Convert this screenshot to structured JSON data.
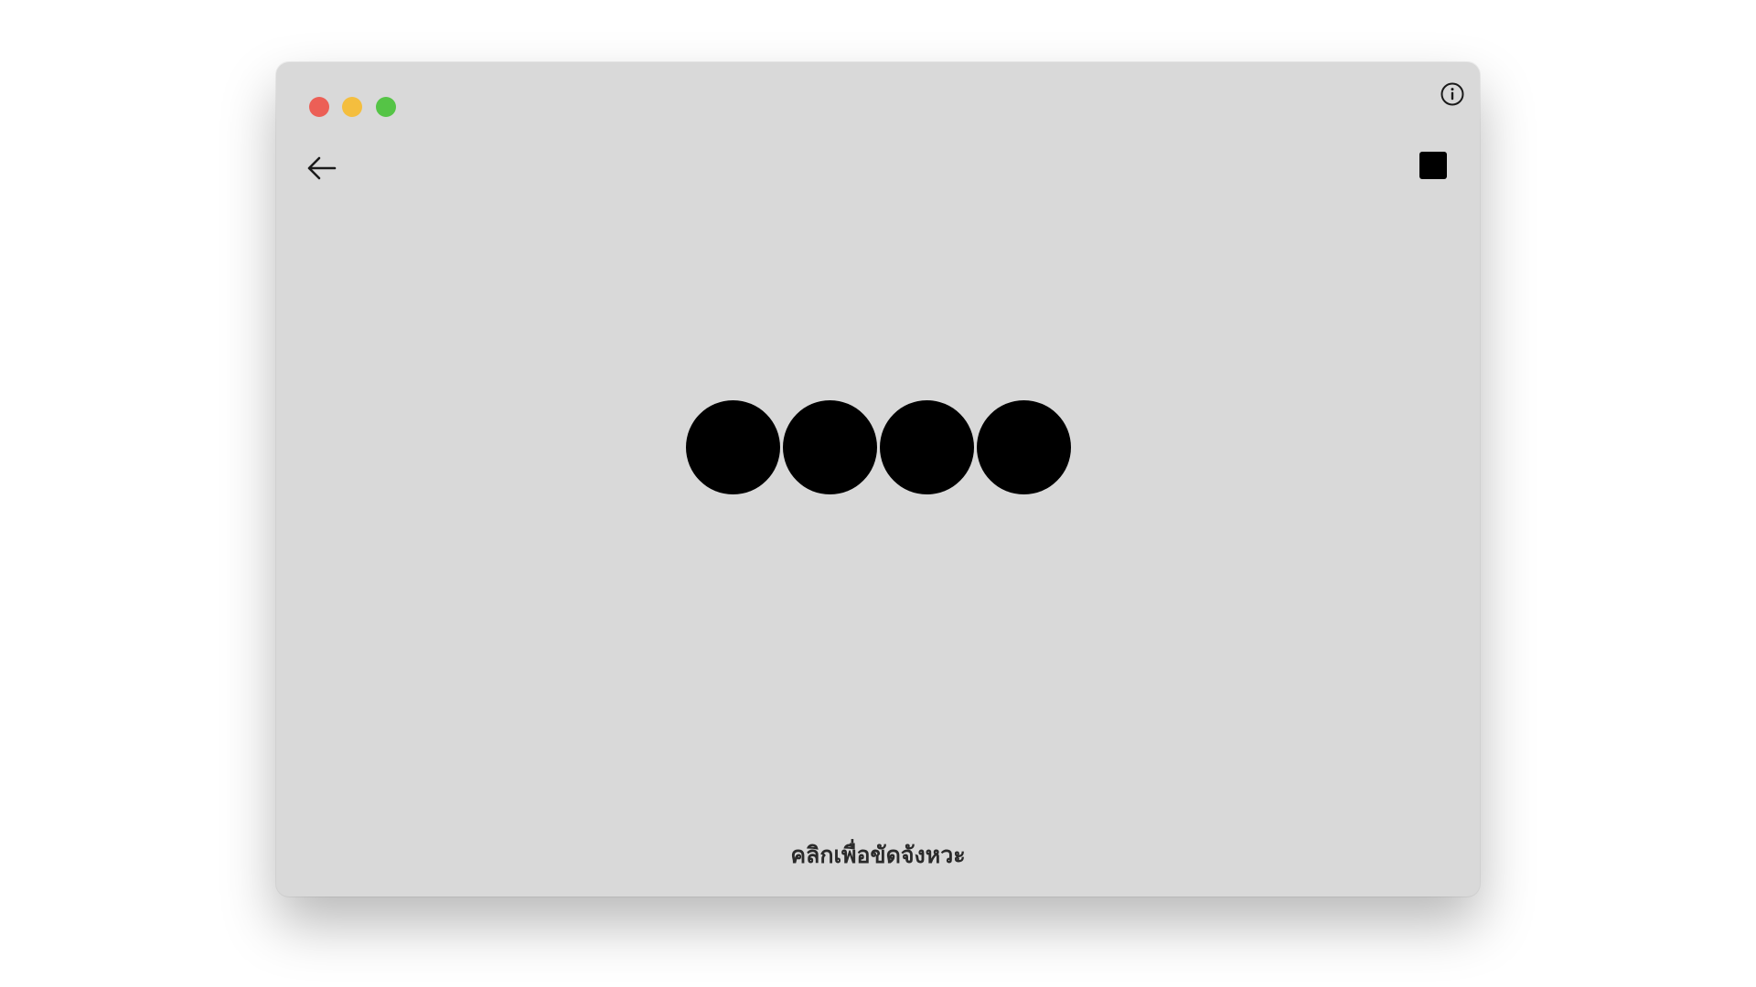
{
  "window": {
    "background": "#d9d9d9"
  },
  "titlebar": {
    "traffic_lights": [
      {
        "name": "close",
        "color": "#ec5f56"
      },
      {
        "name": "minimize",
        "color": "#f4be3e"
      },
      {
        "name": "maximize",
        "color": "#55c446"
      }
    ],
    "info_icon": "info-circle-icon"
  },
  "toolbar": {
    "back_icon": "arrow-left-icon",
    "stop_icon": "stop-square-icon"
  },
  "metronome": {
    "beat_count": 4,
    "beat_color": "#000000"
  },
  "hint": {
    "text": "คลิกเพื่อขัดจังหวะ"
  }
}
